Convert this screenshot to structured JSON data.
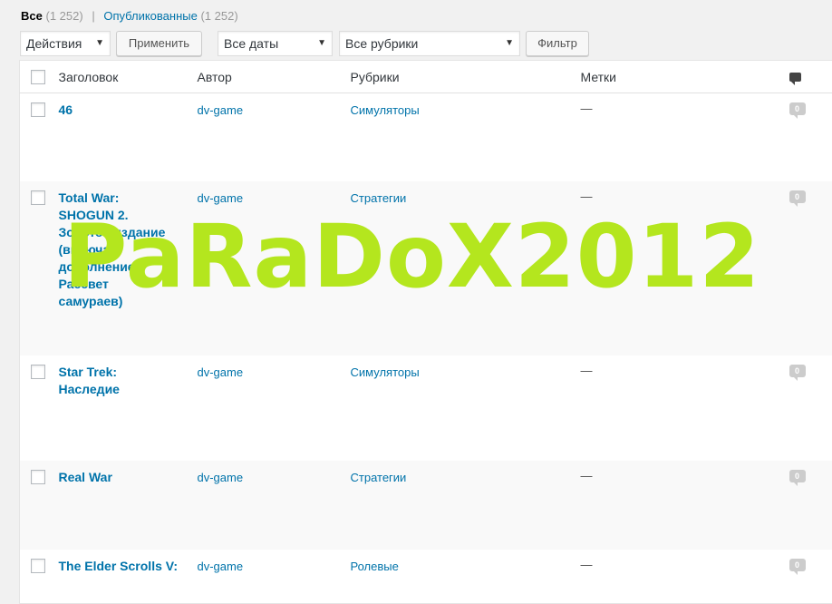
{
  "filters": {
    "all_label": "Все",
    "all_count": "(1 252)",
    "separator": "|",
    "published_label": "Опубликованные",
    "published_count": "(1 252)"
  },
  "toolbar": {
    "actions_select": "Действия",
    "apply_button": "Применить",
    "dates_select": "Все даты",
    "categories_select": "Все рубрики",
    "filter_button": "Фильтр"
  },
  "columns": {
    "title": "Заголовок",
    "author": "Автор",
    "categories": "Рубрики",
    "tags": "Метки",
    "comments_icon": "comment-icon"
  },
  "rows": [
    {
      "title": "46",
      "author": "dv-game",
      "category": "Симуляторы",
      "tags": "—",
      "comments": "0"
    },
    {
      "title": "Total War: SHOGUN 2. Золотое издание (включая дополнение Рассвет самураев)",
      "author": "dv-game",
      "category": "Стратегии",
      "tags": "—",
      "comments": "0"
    },
    {
      "title": "Star Trek: Наследие",
      "author": "dv-game",
      "category": "Симуляторы",
      "tags": "—",
      "comments": "0"
    },
    {
      "title": "Real War",
      "author": "dv-game",
      "category": "Стратегии",
      "tags": "—",
      "comments": "0"
    },
    {
      "title": "The Elder Scrolls V:",
      "author": "dv-game",
      "category": "Ролевые",
      "tags": "—",
      "comments": "0"
    }
  ],
  "watermark": "PaRaDoX2012",
  "colors": {
    "link": "#0073aa",
    "watermark": "#b4e61e",
    "background": "#f1f1f1"
  }
}
